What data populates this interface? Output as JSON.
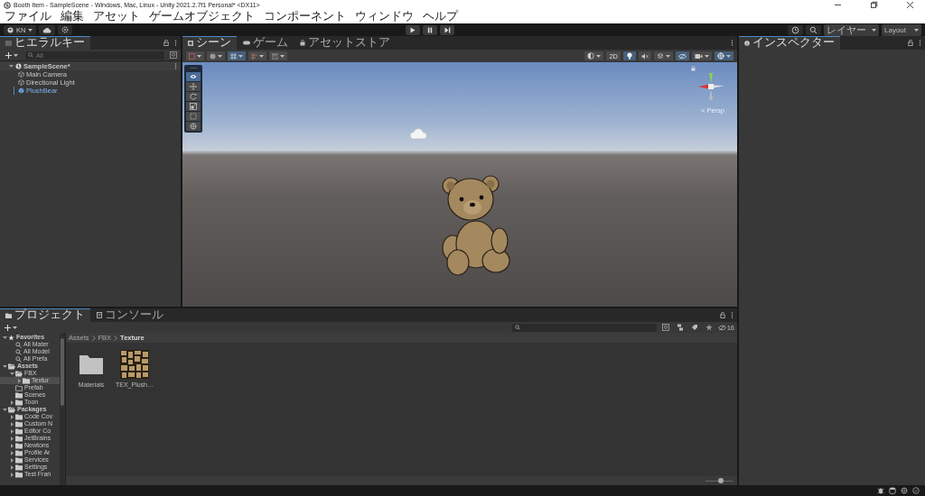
{
  "window": {
    "title": "Booth Item - SampleScene - Windows, Mac, Linux - Unity 2021.2.7f1 Personal* <DX11>"
  },
  "menu": [
    "ファイル",
    "編集",
    "アセット",
    "ゲームオブジェクト",
    "コンポーネント",
    "ウィンドウ",
    "ヘルプ"
  ],
  "toolbar": {
    "account": "KN",
    "layers": "レイヤー",
    "layout": "Layout"
  },
  "hierarchy": {
    "tab": "ヒエラルキー",
    "search_placeholder": "All",
    "items": [
      {
        "label": "SampleScene*",
        "kind": "scene",
        "expanded": true,
        "children": [
          {
            "label": "Main Camera",
            "kind": "object"
          },
          {
            "label": "Directional Light",
            "kind": "object"
          },
          {
            "label": "PlushBear",
            "kind": "prefab"
          }
        ]
      }
    ]
  },
  "scene_view": {
    "tabs": [
      {
        "label": "シーン",
        "kind": "scene",
        "selected": true
      },
      {
        "label": "ゲーム",
        "kind": "game",
        "selected": false
      },
      {
        "label": "アセットストア",
        "kind": "store",
        "selected": false
      }
    ],
    "mode_2d": {
      "label": "2D",
      "selected": false
    },
    "toggles": [
      {
        "kind": "lighting",
        "selected": true
      },
      {
        "kind": "audio",
        "selected": false
      },
      {
        "kind": "effects",
        "selected": false
      },
      {
        "kind": "visibility",
        "selected": true
      },
      {
        "kind": "camera",
        "selected": false
      },
      {
        "kind": "gizmos",
        "selected": true
      }
    ],
    "tools": [
      {
        "kind": "view",
        "selected": true
      },
      {
        "kind": "move",
        "selected": false
      },
      {
        "kind": "rotate",
        "selected": false
      },
      {
        "kind": "scale",
        "selected": false
      },
      {
        "kind": "rect",
        "selected": false
      },
      {
        "kind": "transform",
        "selected": false
      }
    ],
    "persp": "< Persp"
  },
  "inspector": {
    "tab": "インスペクター"
  },
  "project": {
    "tabs": [
      {
        "label": "プロジェクト",
        "kind": "project",
        "selected": true
      },
      {
        "label": "コンソール",
        "kind": "console",
        "selected": false
      }
    ],
    "tree": [
      {
        "label": "Favorites",
        "kind": "favorites",
        "expanded": true,
        "selected": false,
        "children": [
          {
            "label": "All Mater",
            "kind": "search",
            "selected": false
          },
          {
            "label": "All Model",
            "kind": "search",
            "selected": false
          },
          {
            "label": "All Prefa",
            "kind": "search",
            "selected": false
          }
        ]
      },
      {
        "label": "Assets",
        "kind": "group",
        "expanded": true,
        "selected": false,
        "children": [
          {
            "label": "FBX",
            "kind": "open-folder",
            "expanded": true,
            "selected": false,
            "children": [
              {
                "label": "Textur",
                "kind": "folder",
                "expanded": false,
                "selected": true
              }
            ]
          },
          {
            "label": "Prefab",
            "kind": "empty-folder",
            "selected": false
          },
          {
            "label": "Scenes",
            "kind": "folder",
            "selected": false
          },
          {
            "label": "Toon",
            "kind": "folder",
            "expanded": false,
            "selected": false
          }
        ]
      },
      {
        "label": "Packages",
        "kind": "group",
        "expanded": true,
        "selected": false,
        "children": [
          {
            "label": "Code Cov",
            "kind": "folder",
            "expanded": false,
            "selected": false
          },
          {
            "label": "Custom N",
            "kind": "folder",
            "expanded": false,
            "selected": false
          },
          {
            "label": "Editor Co",
            "kind": "folder",
            "expanded": false,
            "selected": false
          },
          {
            "label": "JetBrains",
            "kind": "folder",
            "expanded": false,
            "selected": false
          },
          {
            "label": "Newtons",
            "kind": "folder",
            "expanded": false,
            "selected": false
          },
          {
            "label": "Profile Ar",
            "kind": "folder",
            "expanded": false,
            "selected": false
          },
          {
            "label": "Services",
            "kind": "folder",
            "expanded": false,
            "selected": false
          },
          {
            "label": "Settings",
            "kind": "folder",
            "expanded": false,
            "selected": false
          },
          {
            "label": "Test Fran",
            "kind": "folder",
            "expanded": false,
            "selected": false
          }
        ]
      }
    ],
    "breadcrumb": [
      "Assets",
      "FBX",
      "Texture"
    ],
    "assets": [
      {
        "name": "Materials",
        "kind": "folder"
      },
      {
        "name": "TEX_Plush…",
        "kind": "texture"
      }
    ],
    "hidden_count": "16",
    "zoom": {
      "level": 0.57
    }
  }
}
